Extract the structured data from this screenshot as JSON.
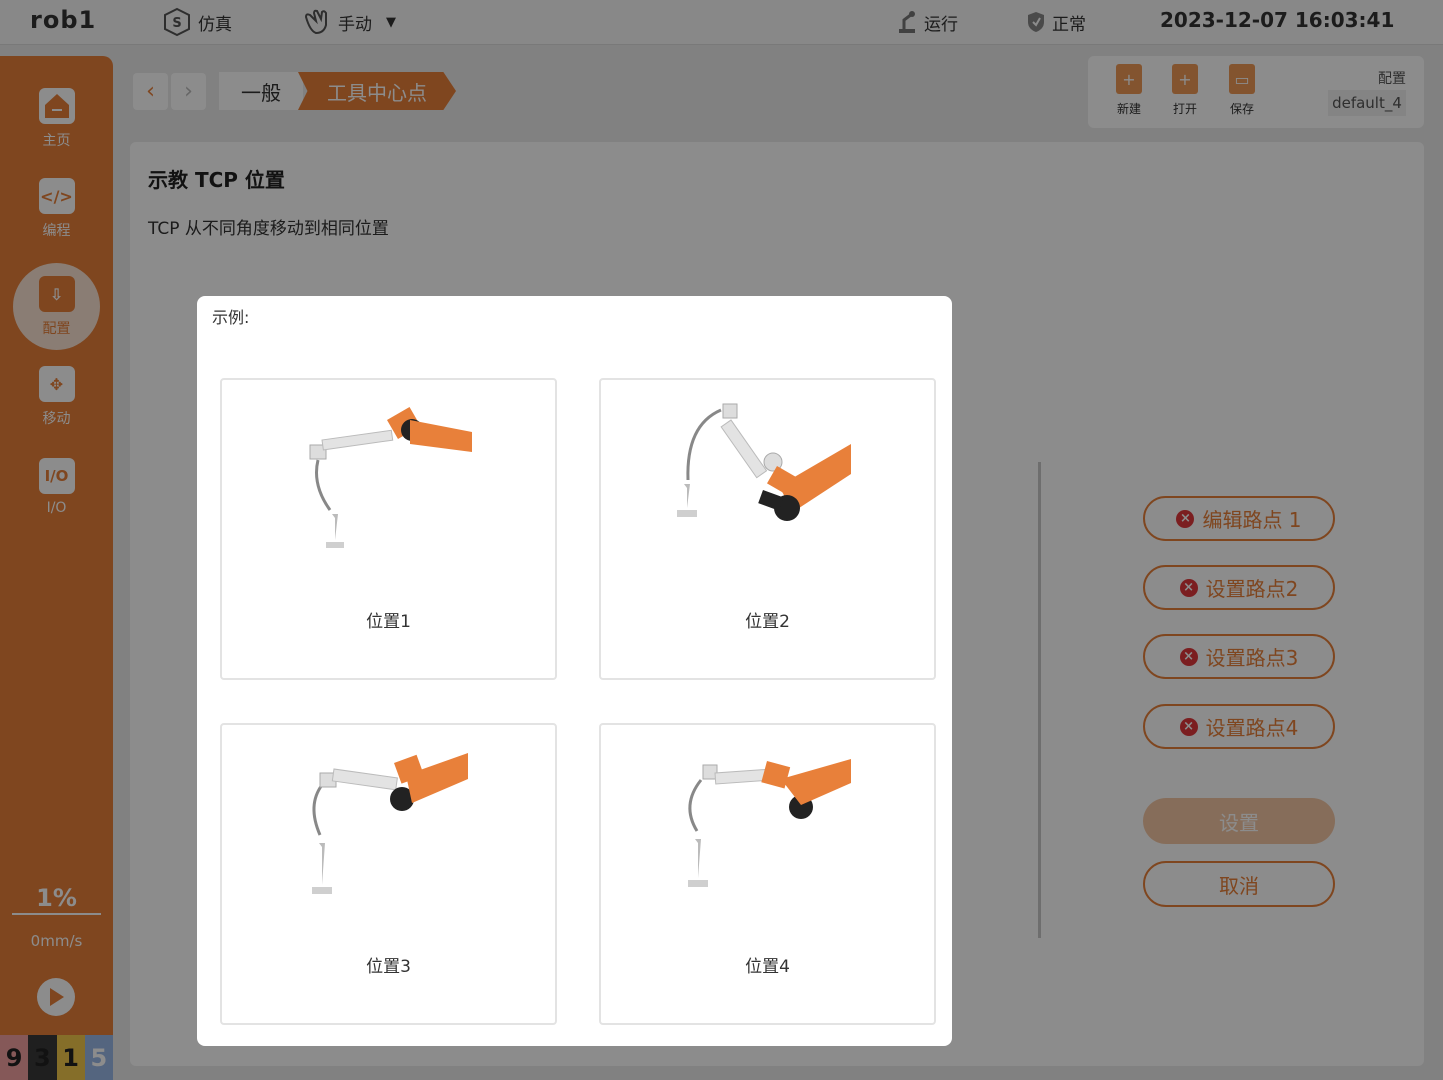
{
  "topbar": {
    "robot_name": "rob1",
    "mode": "仿真",
    "control": "手动",
    "run_state": "运行",
    "status": "正常",
    "datetime": "2023-12-07 16:03:41"
  },
  "sidebar": {
    "items": [
      {
        "label": "主页",
        "icon": "home-icon"
      },
      {
        "label": "编程",
        "icon": "code-icon"
      },
      {
        "label": "配置",
        "icon": "config-icon"
      },
      {
        "label": "移动",
        "icon": "move-icon"
      },
      {
        "label": "I/O",
        "icon": "io-icon"
      }
    ],
    "active": "配置",
    "speed_percent": "1%",
    "speed_mm": "0mm/s",
    "digits": [
      {
        "value": "9",
        "color": "#f3a0a0"
      },
      {
        "value": "3",
        "color": "#3a3a3a"
      },
      {
        "value": "1",
        "color": "#f2c94c"
      },
      {
        "value": "5",
        "color": "#9ab9e8"
      }
    ]
  },
  "breadcrumb": {
    "back_label": "‹",
    "forward_label": "›",
    "items": [
      "一般",
      "工具中心点"
    ]
  },
  "file_actions": {
    "new_label": "新建",
    "open_label": "打开",
    "save_label": "保存",
    "config_label": "配置",
    "config_value": "default_4"
  },
  "panel": {
    "title": "示教 TCP 位置",
    "description": "TCP 从不同角度移动到相同位置"
  },
  "waypoints": [
    {
      "label": "编辑路点 1"
    },
    {
      "label": "设置路点2"
    },
    {
      "label": "设置路点3"
    },
    {
      "label": "设置路点4"
    }
  ],
  "actions": {
    "set_label": "设置",
    "cancel_label": "取消"
  },
  "modal": {
    "label": "示例:",
    "cards": [
      {
        "caption": "位置1"
      },
      {
        "caption": "位置2"
      },
      {
        "caption": "位置3"
      },
      {
        "caption": "位置4"
      }
    ]
  },
  "colors": {
    "accent": "#e8803a",
    "error": "#e0383b"
  }
}
